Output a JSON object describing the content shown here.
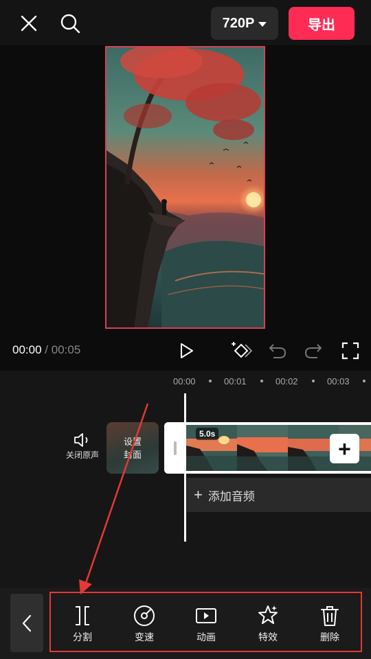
{
  "header": {
    "resolution_label": "720P",
    "export_label": "导出"
  },
  "player": {
    "current_time": "00:00",
    "separator": "/",
    "duration": "00:05"
  },
  "ruler": [
    "00:00",
    "00:01",
    "00:02",
    "00:03"
  ],
  "track": {
    "mute_label": "关闭原声",
    "cover_label_line1": "设置",
    "cover_label_line2": "封面",
    "clip_duration": "5.0s",
    "add_clip_symbol": "+",
    "add_audio_label": "添加音频"
  },
  "toolbar": {
    "items": [
      {
        "label": "分割",
        "icon": "split-icon"
      },
      {
        "label": "变速",
        "icon": "speed-icon"
      },
      {
        "label": "动画",
        "icon": "animation-icon"
      },
      {
        "label": "特效",
        "icon": "effects-icon"
      },
      {
        "label": "删除",
        "icon": "delete-icon"
      }
    ]
  },
  "colors": {
    "accent": "#fe2c55",
    "annotation": "#e53935"
  }
}
